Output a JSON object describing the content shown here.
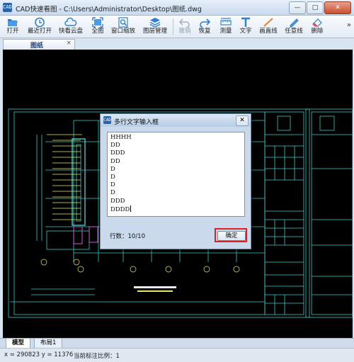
{
  "window": {
    "app_logo": "CAD",
    "title": "CAD快速看图 - C:\\Users\\Administrator\\Desktop\\图纸.dwg",
    "buttons": [
      "minimize",
      "maximize",
      "close"
    ],
    "minimize_glyph": "—",
    "maximize_glyph": "□",
    "close_glyph": "✕"
  },
  "toolbar": {
    "items": [
      {
        "label": "打开",
        "icon": "folder-open-icon",
        "enabled": true
      },
      {
        "label": "最近打开",
        "icon": "clock-icon",
        "enabled": true
      },
      {
        "label": "快看云盘",
        "icon": "cloud-icon",
        "enabled": true
      },
      {
        "label": "全图",
        "icon": "fit-view-icon",
        "enabled": true
      },
      {
        "label": "窗口缩放",
        "icon": "zoom-window-icon",
        "enabled": true
      },
      {
        "label": "图层管理",
        "icon": "layers-icon",
        "enabled": true
      },
      {
        "label": "撤销",
        "icon": "undo-icon",
        "enabled": false
      },
      {
        "label": "恢复",
        "icon": "redo-icon",
        "enabled": true
      },
      {
        "label": "测量",
        "icon": "ruler-icon",
        "enabled": true
      },
      {
        "label": "文字",
        "icon": "text-icon",
        "enabled": true
      },
      {
        "label": "画直线",
        "icon": "line-icon",
        "enabled": true
      },
      {
        "label": "任意线",
        "icon": "pen-icon",
        "enabled": true
      },
      {
        "label": "删除",
        "icon": "eraser-icon",
        "enabled": true
      }
    ],
    "more_glyph": "»"
  },
  "doc_tab": {
    "label": "图纸",
    "close_glyph": "×"
  },
  "bottom_tabs": [
    {
      "label": "模型",
      "active": true
    },
    {
      "label": "布局1",
      "active": false
    }
  ],
  "status": {
    "coords": "x = 290823  y = 11376",
    "scale": "当前标注比例：1"
  },
  "dialog": {
    "logo": "CAD",
    "title": "多行文字输入框",
    "close_glyph": "✕",
    "lines": [
      "HHHH",
      "DD",
      "DDD",
      "DD",
      "D",
      "D",
      "D",
      "D",
      "DDD",
      "DDDD"
    ],
    "line_count": "行数：10/10",
    "ok_label": "确定"
  },
  "colors": {
    "canvas_bg": "#000000",
    "drawing_line": "#3ec9c9",
    "drawing_accent": "#e8e85a",
    "highlight": "#e0201c"
  }
}
